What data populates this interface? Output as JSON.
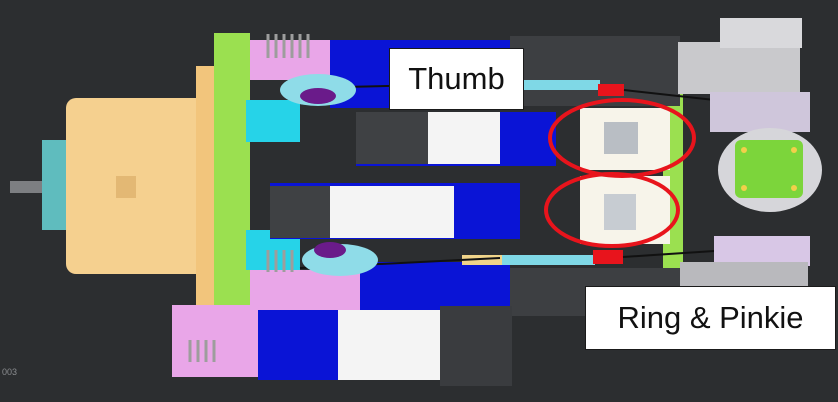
{
  "labels": {
    "thumb": "Thumb",
    "ring_pinkie": "Ring & Pinkie",
    "frame_number": "003"
  },
  "colors": {
    "background": "#2c2e30",
    "motor_body": "#f5d08f",
    "mount_plate": "#9be050",
    "actuator_blue": "#0a14d6",
    "bracket_pink": "#e9a6e8",
    "cyan_part": "#26d3e8",
    "steel_white": "#f4f4f4",
    "dark_gray": "#3d3f42",
    "highlight_ellipse": "#e8141c"
  },
  "icons": [
    "motor-icon",
    "spring-icon",
    "pulley-icon",
    "circuit-board-icon"
  ]
}
